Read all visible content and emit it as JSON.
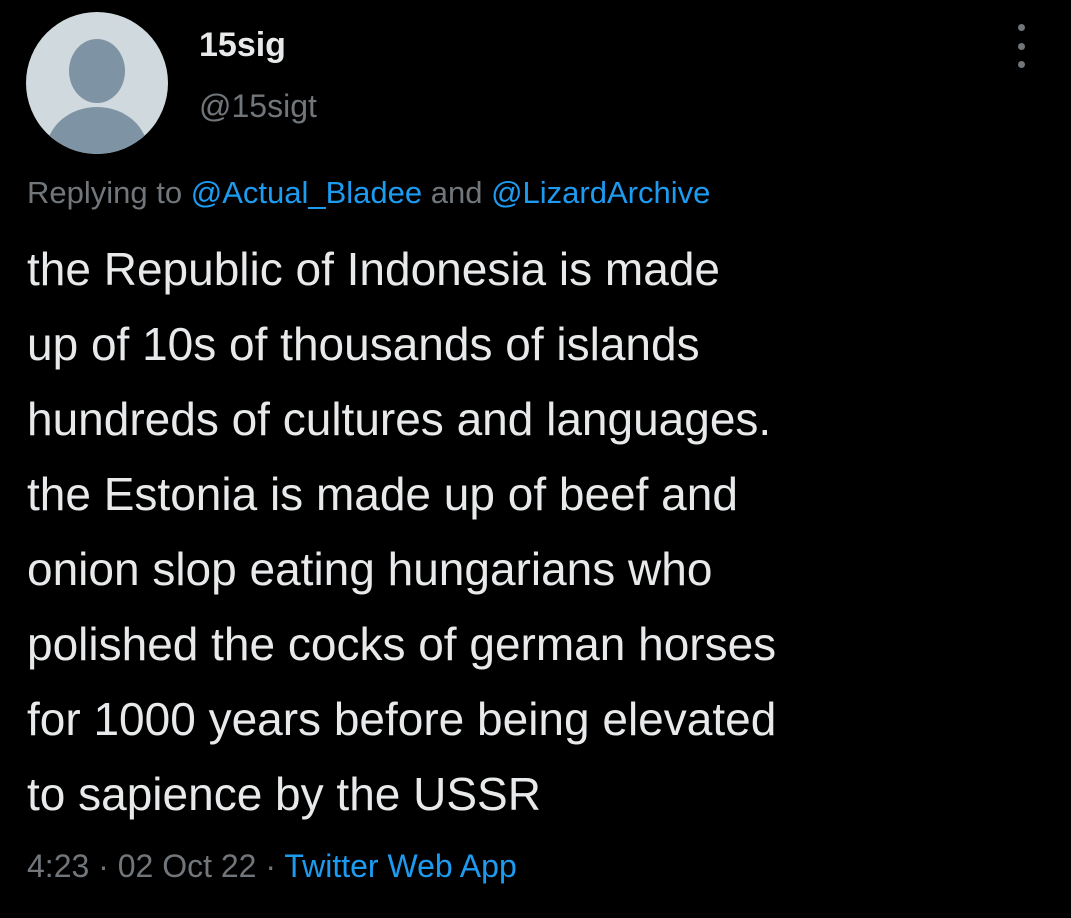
{
  "author": {
    "display_name": "15sig",
    "handle": "@15sigt"
  },
  "reply_context": {
    "prefix": "Replying to ",
    "mention_1": "@Actual_Bladee",
    "joiner": " and ",
    "mention_2": "@LizardArchive"
  },
  "tweet": {
    "lines": [
      "the Republic of Indonesia is made",
      "up of 10s of thousands of islands",
      "hundreds of cultures and languages.",
      "the Estonia is made up of beef and",
      "onion slop eating hungarians who",
      "polished the cocks of german horses",
      "for 1000 years before being elevated",
      "to sapience by the USSR"
    ]
  },
  "meta": {
    "time": "4:23",
    "separator": " · ",
    "date": "02 Oct 22",
    "source": "Twitter Web App"
  },
  "icons": {
    "avatar": "default-avatar-icon",
    "more": "more-options-icon"
  },
  "colors": {
    "background": "#000000",
    "text": "#e7e9ea",
    "secondary": "#71767b",
    "link": "#1d9bf0"
  }
}
